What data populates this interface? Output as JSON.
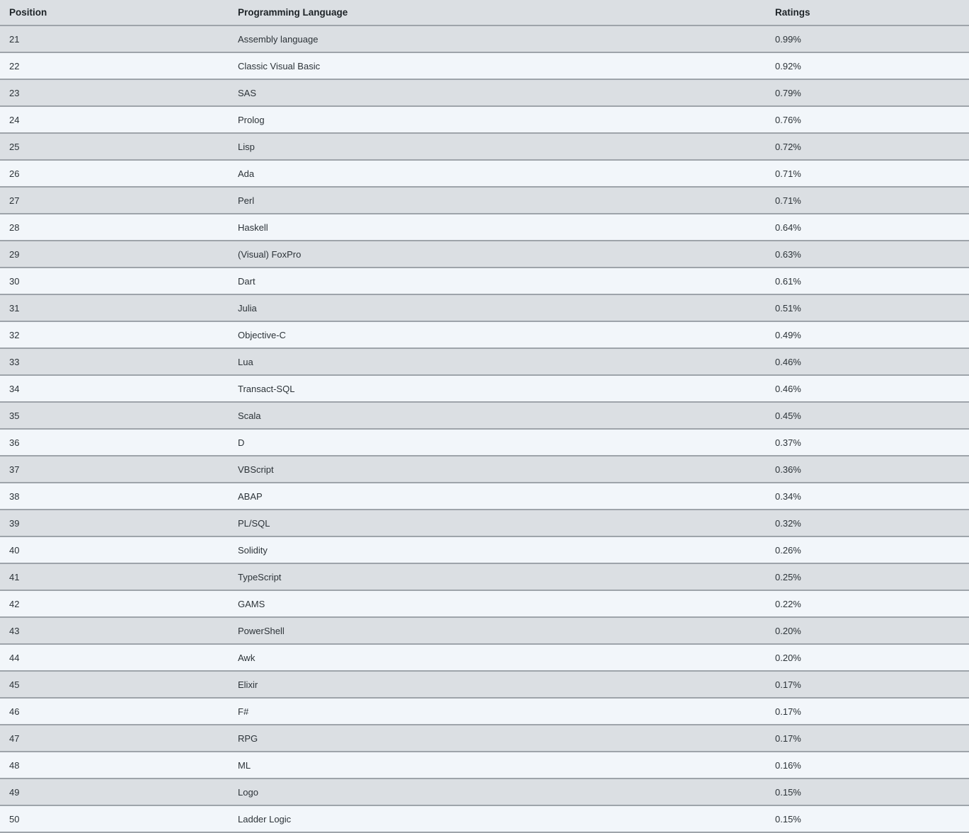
{
  "table": {
    "name": "programming-language-ranking-table",
    "columns": [
      {
        "key": "position",
        "label": "Position"
      },
      {
        "key": "language",
        "label": "Programming Language"
      },
      {
        "key": "ratings",
        "label": "Ratings"
      }
    ],
    "colors": {
      "header_background": "#dbdfe3",
      "row_odd_background": "#dbdfe3",
      "row_even_background": "#f2f6fa",
      "row_border": "#9ea4aa",
      "text": "#2c3338",
      "header_text": "#1d2327"
    },
    "rows": [
      {
        "position": "21",
        "language": "Assembly language",
        "ratings": "0.99%"
      },
      {
        "position": "22",
        "language": "Classic Visual Basic",
        "ratings": "0.92%"
      },
      {
        "position": "23",
        "language": "SAS",
        "ratings": "0.79%"
      },
      {
        "position": "24",
        "language": "Prolog",
        "ratings": "0.76%"
      },
      {
        "position": "25",
        "language": "Lisp",
        "ratings": "0.72%"
      },
      {
        "position": "26",
        "language": "Ada",
        "ratings": "0.71%"
      },
      {
        "position": "27",
        "language": "Perl",
        "ratings": "0.71%"
      },
      {
        "position": "28",
        "language": "Haskell",
        "ratings": "0.64%"
      },
      {
        "position": "29",
        "language": "(Visual) FoxPro",
        "ratings": "0.63%"
      },
      {
        "position": "30",
        "language": "Dart",
        "ratings": "0.61%"
      },
      {
        "position": "31",
        "language": "Julia",
        "ratings": "0.51%"
      },
      {
        "position": "32",
        "language": "Objective-C",
        "ratings": "0.49%"
      },
      {
        "position": "33",
        "language": "Lua",
        "ratings": "0.46%"
      },
      {
        "position": "34",
        "language": "Transact-SQL",
        "ratings": "0.46%"
      },
      {
        "position": "35",
        "language": "Scala",
        "ratings": "0.45%"
      },
      {
        "position": "36",
        "language": "D",
        "ratings": "0.37%"
      },
      {
        "position": "37",
        "language": "VBScript",
        "ratings": "0.36%"
      },
      {
        "position": "38",
        "language": "ABAP",
        "ratings": "0.34%"
      },
      {
        "position": "39",
        "language": "PL/SQL",
        "ratings": "0.32%"
      },
      {
        "position": "40",
        "language": "Solidity",
        "ratings": "0.26%"
      },
      {
        "position": "41",
        "language": "TypeScript",
        "ratings": "0.25%"
      },
      {
        "position": "42",
        "language": "GAMS",
        "ratings": "0.22%"
      },
      {
        "position": "43",
        "language": "PowerShell",
        "ratings": "0.20%"
      },
      {
        "position": "44",
        "language": "Awk",
        "ratings": "0.20%"
      },
      {
        "position": "45",
        "language": "Elixir",
        "ratings": "0.17%"
      },
      {
        "position": "46",
        "language": "F#",
        "ratings": "0.17%"
      },
      {
        "position": "47",
        "language": "RPG",
        "ratings": "0.17%"
      },
      {
        "position": "48",
        "language": "ML",
        "ratings": "0.16%"
      },
      {
        "position": "49",
        "language": "Logo",
        "ratings": "0.15%"
      },
      {
        "position": "50",
        "language": "Ladder Logic",
        "ratings": "0.15%"
      }
    ]
  }
}
